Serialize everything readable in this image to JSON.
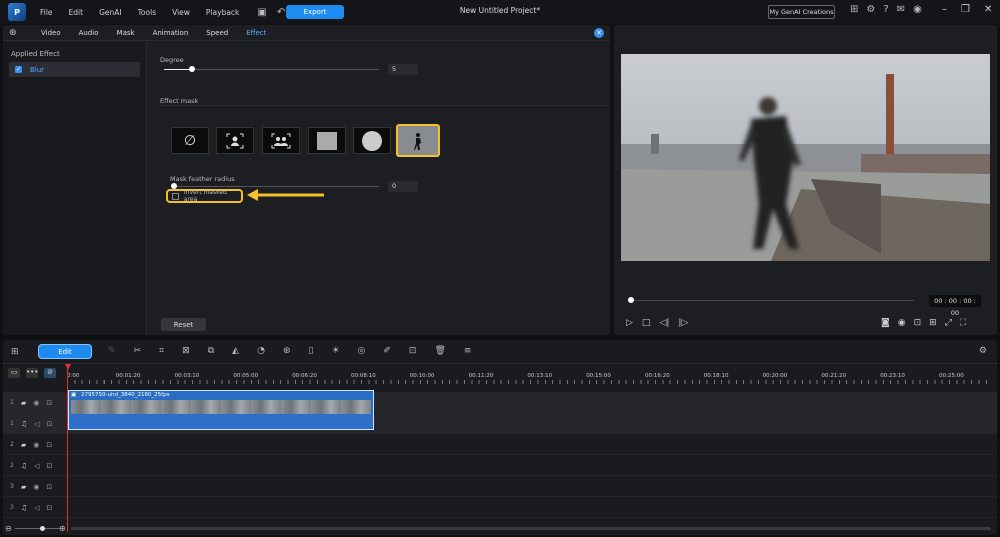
{
  "app": {
    "menu": [
      "File",
      "Edit",
      "GenAI",
      "Tools",
      "View",
      "Playback"
    ],
    "export_label": "Export",
    "project_title": "New Untitled Project*",
    "genai_button": "My GenAI Creations"
  },
  "effect_panel": {
    "tabs": [
      "Video",
      "Audio",
      "Mask",
      "Animation",
      "Speed",
      "Effect"
    ],
    "active_tab": "Effect",
    "applied_title": "Applied Effect",
    "applied_items": [
      "Blur"
    ],
    "degree_label": "Degree",
    "degree_value": "5",
    "degree_level": 0.13,
    "effect_mask_label": "Effect mask",
    "feather_label": "Mask feather radius",
    "feather_value": "0",
    "feather_level": 0.0,
    "invert_label": "Invert masked area",
    "reset_label": "Reset",
    "highlight_color": "#f5c02a",
    "mask_options": [
      "none-icon",
      "person-icon",
      "group-icon",
      "rectangle-icon",
      "circle-icon",
      "custom-mask-icon"
    ]
  },
  "preview": {
    "timecode": "00 : 00 : 00 : 00"
  },
  "timeline": {
    "edit_label": "Edit",
    "ruler_labels": [
      "0:00",
      "00:01:20",
      "00:03:10",
      "00:05:00",
      "00:06:20",
      "00:08:10",
      "00:10:00",
      "00:11:20",
      "00:13:10",
      "00:15:00",
      "00:16:20",
      "00:18:10",
      "00:20:00",
      "00:21:20",
      "00:23:10",
      "00:25:00"
    ],
    "clip_name": "2795750-uhd_3840_2160_25fps",
    "track_numbers": [
      "1",
      "1",
      "2",
      "2",
      "3",
      "3"
    ]
  }
}
